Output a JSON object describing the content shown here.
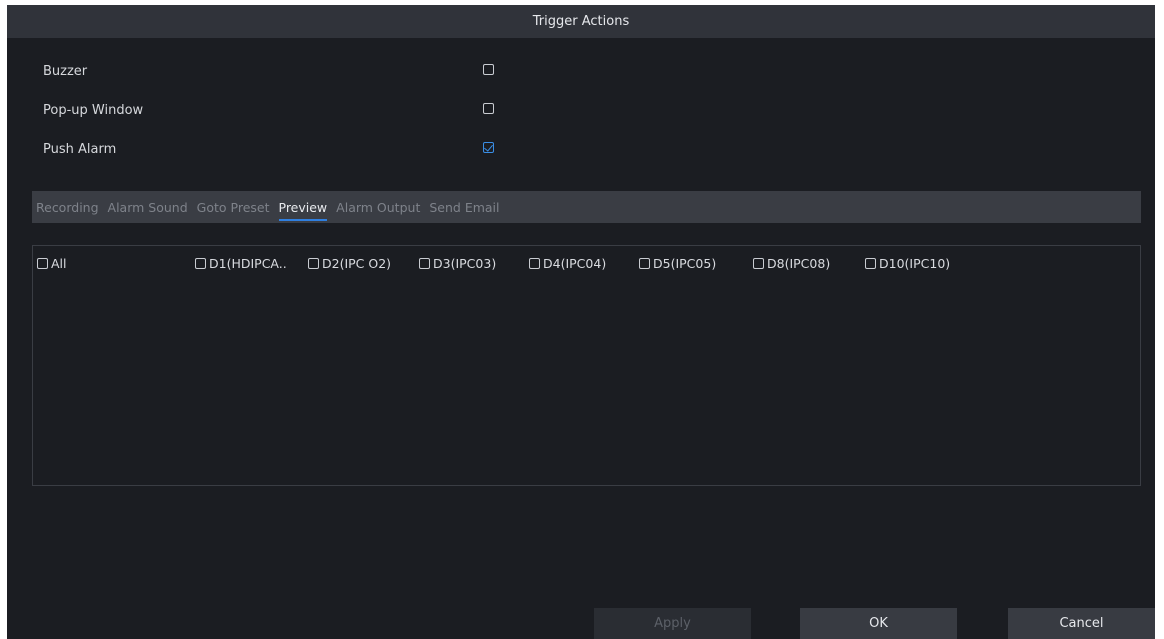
{
  "dialog": {
    "title": "Trigger Actions"
  },
  "options": [
    {
      "label": "Buzzer",
      "checked": false
    },
    {
      "label": "Pop-up Window",
      "checked": false
    },
    {
      "label": "Push Alarm",
      "checked": true
    }
  ],
  "tabs": [
    {
      "label": "Recording",
      "active": false
    },
    {
      "label": "Alarm Sound",
      "active": false
    },
    {
      "label": "Goto Preset",
      "active": false
    },
    {
      "label": "Preview",
      "active": true
    },
    {
      "label": "Alarm Output",
      "active": false
    },
    {
      "label": "Send Email",
      "active": false
    }
  ],
  "channels": [
    {
      "label": "All",
      "checked": false
    },
    {
      "label": "D1(HDIPCA..",
      "checked": false
    },
    {
      "label": "D2(IPC O2)",
      "checked": false
    },
    {
      "label": "D3(IPC03)",
      "checked": false
    },
    {
      "label": "D4(IPC04)",
      "checked": false
    },
    {
      "label": "D5(IPC05)",
      "checked": false
    },
    {
      "label": "D8(IPC08)",
      "checked": false
    },
    {
      "label": "D10(IPC10)",
      "checked": false
    }
  ],
  "buttons": {
    "apply": "Apply",
    "ok": "OK",
    "cancel": "Cancel"
  },
  "colors": {
    "accent": "#2f7fe0",
    "background": "#1b1d22",
    "titlebar": "#30333a"
  }
}
